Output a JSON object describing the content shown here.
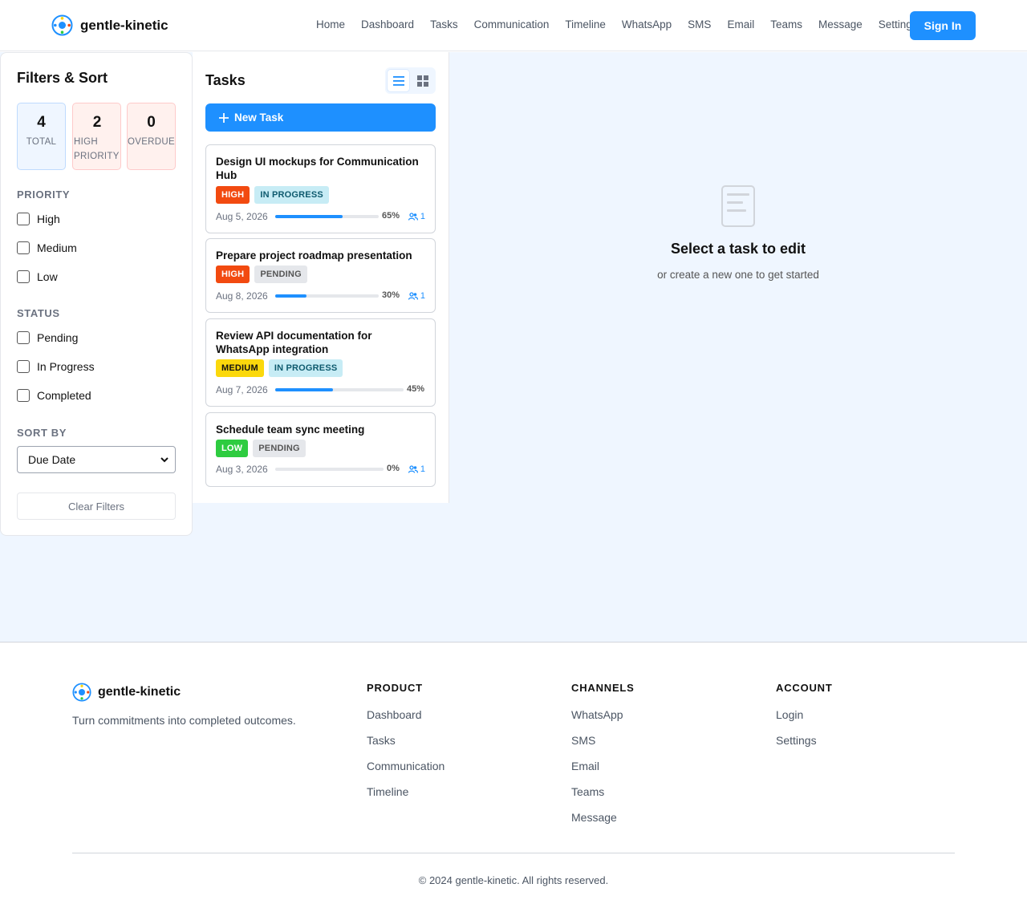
{
  "app": {
    "name": "gentle-kinetic"
  },
  "nav": {
    "items": [
      "Home",
      "Dashboard",
      "Tasks",
      "Communication",
      "Timeline",
      "WhatsApp",
      "SMS",
      "Email",
      "Teams",
      "Message",
      "Settings"
    ],
    "signin_label": "Sign In"
  },
  "filters": {
    "title": "Filters & Sort",
    "stats": {
      "total": {
        "value": "4",
        "label": "TOTAL"
      },
      "high": {
        "value": "2",
        "label": "HIGH PRIORITY"
      },
      "overdue": {
        "value": "0",
        "label": "OVERDUE"
      }
    },
    "priority_title": "PRIORITY",
    "priority": [
      "High",
      "Medium",
      "Low"
    ],
    "status_title": "STATUS",
    "status": [
      "Pending",
      "In Progress",
      "Completed"
    ],
    "sort_title": "SORT BY",
    "sort_value": "Due Date",
    "clear_label": "Clear Filters"
  },
  "tasks": {
    "title": "Tasks",
    "new_task_label": "New Task",
    "items": [
      {
        "title": "Design UI mockups for Communication Hub",
        "priority": "HIGH",
        "status": "IN PROGRESS",
        "date": "Aug 5, 2026",
        "progress": 65,
        "progress_label": "65%",
        "assignees": "1"
      },
      {
        "title": "Prepare project roadmap presentation",
        "priority": "HIGH",
        "status": "PENDING",
        "date": "Aug 8, 2026",
        "progress": 30,
        "progress_label": "30%",
        "assignees": "1"
      },
      {
        "title": "Review API documentation for WhatsApp integration",
        "priority": "MEDIUM",
        "status": "IN PROGRESS",
        "date": "Aug 7, 2026",
        "progress": 45,
        "progress_label": "45%",
        "assignees": ""
      },
      {
        "title": "Schedule team sync meeting",
        "priority": "LOW",
        "status": "PENDING",
        "date": "Aug 3, 2026",
        "progress": 0,
        "progress_label": "0%",
        "assignees": "1"
      }
    ]
  },
  "editor": {
    "empty_title": "Select a task to edit",
    "empty_subtitle": "or create a new one to get started",
    "icon": "document-icon"
  },
  "footer": {
    "brand": "gentle-kinetic",
    "tagline": "Turn commitments into completed outcomes.",
    "product_title": "PRODUCT",
    "product": [
      "Dashboard",
      "Tasks",
      "Communication",
      "Timeline"
    ],
    "channels_title": "CHANNELS",
    "channels": [
      "WhatsApp",
      "SMS",
      "Email",
      "Teams",
      "Message"
    ],
    "account_title": "ACCOUNT",
    "account": [
      "Login",
      "Settings"
    ],
    "copyright": "© 2024 gentle-kinetic. All rights reserved."
  },
  "colors": {
    "accent": "#1e90ff",
    "high": "#f24a10",
    "medium": "#fbd80c",
    "low": "#2ecc40",
    "band": "#eff6ff"
  }
}
